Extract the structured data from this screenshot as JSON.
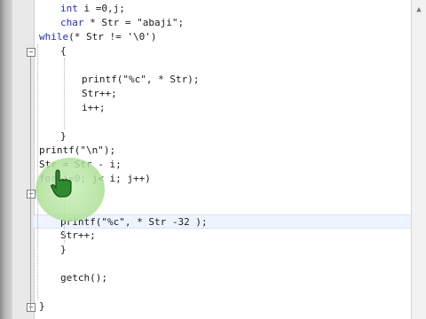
{
  "editor": {
    "lines": [
      {
        "text": "int i =0,j;",
        "indent": 1
      },
      {
        "text": "char * Str = \"abaji\";",
        "indent": 1
      },
      {
        "text": "while(* Str != '\\0')",
        "indent": 0
      },
      {
        "text": "{",
        "indent": 1
      },
      {
        "text": "",
        "indent": 0
      },
      {
        "text": "printf(\"%c\", * Str);",
        "indent": 2
      },
      {
        "text": "Str++;",
        "indent": 2
      },
      {
        "text": "i++;",
        "indent": 2
      },
      {
        "text": "",
        "indent": 0
      },
      {
        "text": "}",
        "indent": 1
      },
      {
        "text": "printf(\"\\n\");",
        "indent": 0
      },
      {
        "text": "Str = Str - i;",
        "indent": 0
      },
      {
        "text": "for(j=0; j< i; j++)",
        "indent": 0
      },
      {
        "text": "{",
        "indent": 1
      },
      {
        "text": "",
        "indent": 0
      },
      {
        "text": "printf(\"%c\", * Str -32 );",
        "indent": 1
      },
      {
        "text": "Str++;",
        "indent": 1
      },
      {
        "text": "}",
        "indent": 1
      },
      {
        "text": "",
        "indent": 0
      },
      {
        "text": "getch();",
        "indent": 1
      },
      {
        "text": "",
        "indent": 0
      },
      {
        "text": "}",
        "indent": 0
      }
    ],
    "current_line": 15,
    "fold_markers": [
      {
        "symbol": "⊟",
        "line": 3
      },
      {
        "symbol": "⊟",
        "line": 13
      },
      {
        "symbol": "⊟",
        "line": 21
      }
    ]
  },
  "cursor": {
    "icon": "hand-pointer-icon",
    "highlight_color": "#b4e39e"
  }
}
